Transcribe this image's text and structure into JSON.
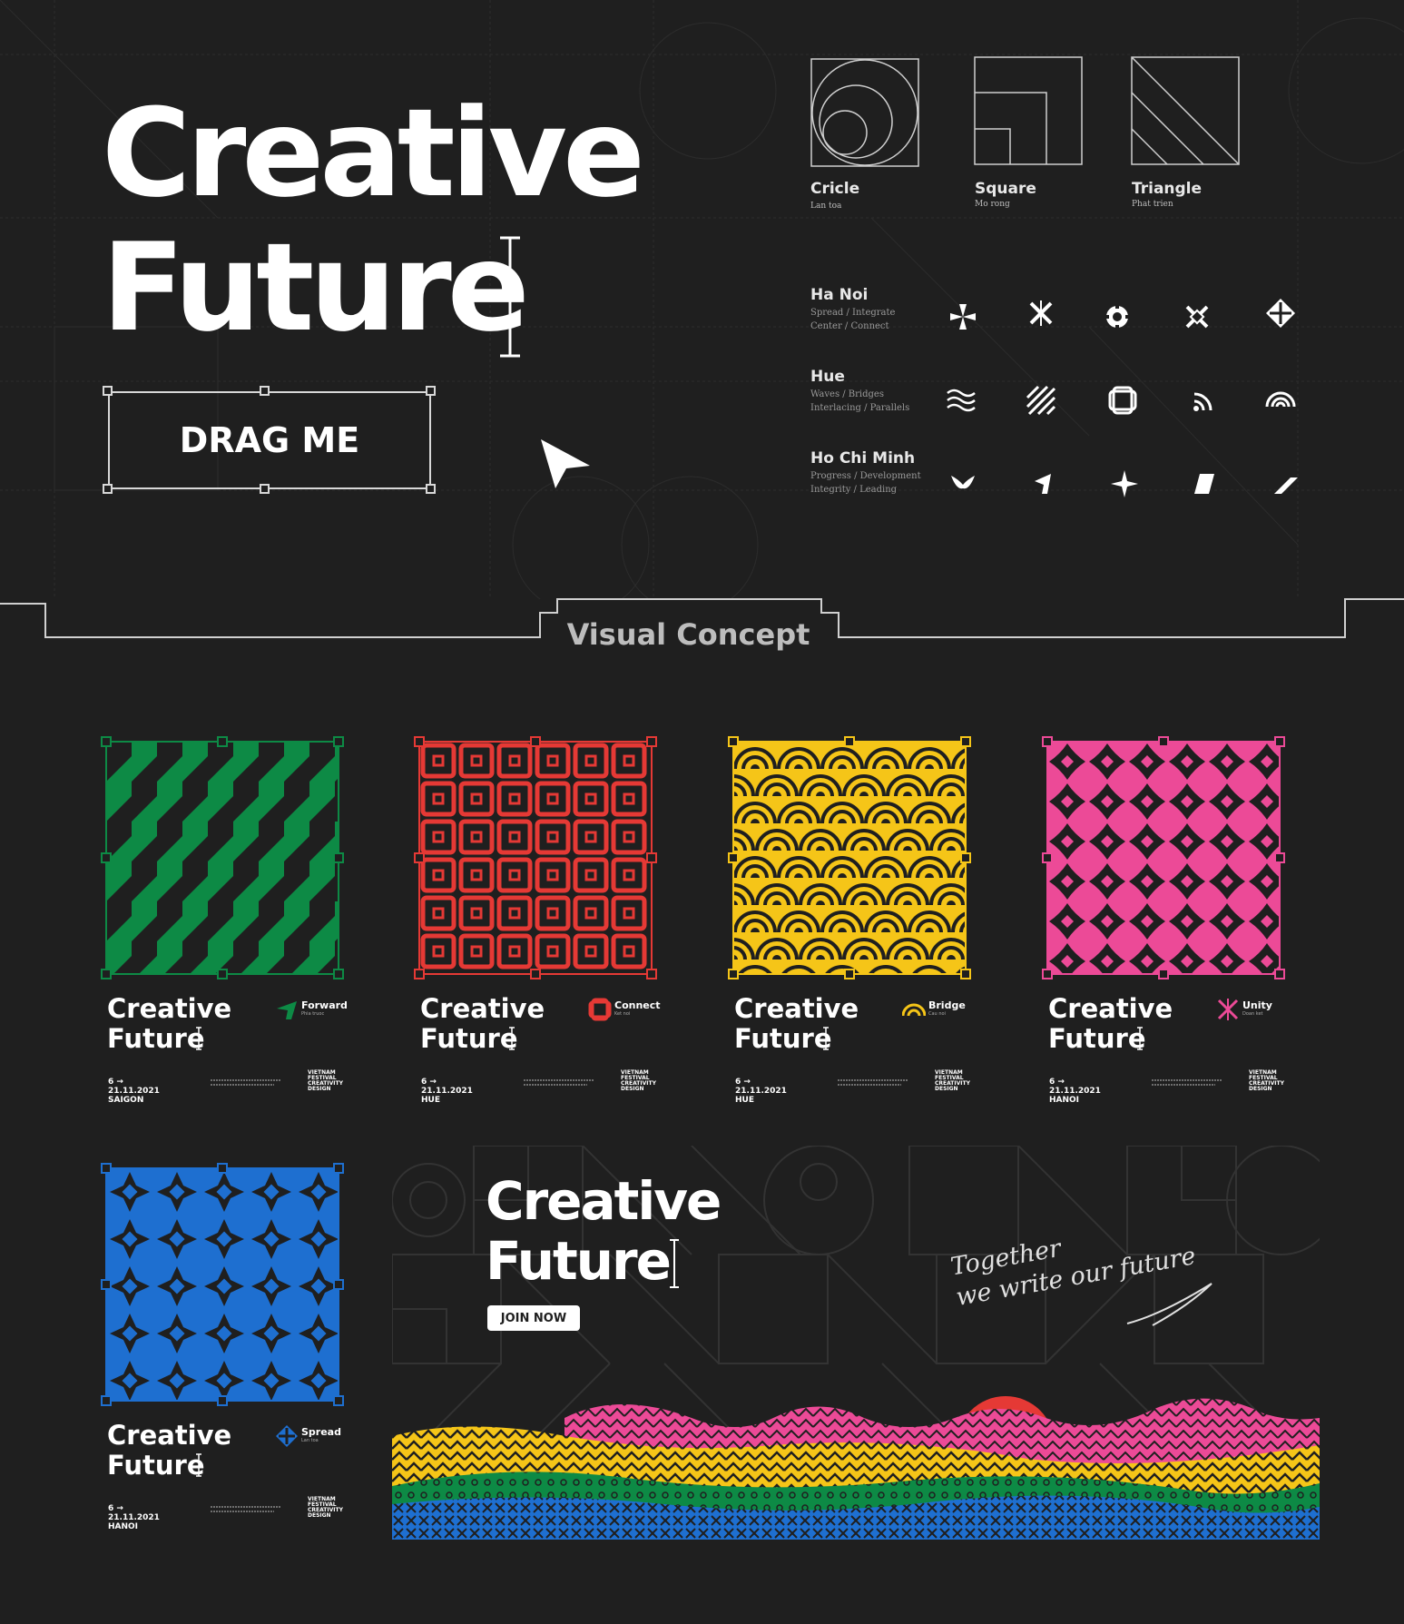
{
  "hero": {
    "title_line1": "Creative",
    "title_line2": "Future",
    "drag_label": "DRAG ME"
  },
  "shapes": [
    {
      "name": "Cricle",
      "sub": "Lan toa"
    },
    {
      "name": "Square",
      "sub": "Mo rong"
    },
    {
      "name": "Triangle",
      "sub": "Phat trien"
    }
  ],
  "cities": [
    {
      "name": "Ha Noi",
      "desc1": "Spread / Integrate",
      "desc2": "Center / Connect"
    },
    {
      "name": "Hue",
      "desc1": "Waves / Bridges",
      "desc2": "Interlacing / Parallels"
    },
    {
      "name": "Ho Chi Minh",
      "desc1": "Progress / Development",
      "desc2": "Integrity / Leading"
    }
  ],
  "section_title": "Visual Concept",
  "cards": [
    {
      "title1": "Creative",
      "title2": "Future",
      "tag": "Forward",
      "tag_sub": "Phia truoc",
      "date": "6 → 21.11.2021 SAIGON",
      "color": "#0d8a45",
      "pattern": "forward"
    },
    {
      "title1": "Creative",
      "title2": "Future",
      "tag": "Connect",
      "tag_sub": "Ket noi",
      "date": "6 → 21.11.2021 HUE",
      "color": "#e53935",
      "pattern": "connect"
    },
    {
      "title1": "Creative",
      "title2": "Future",
      "tag": "Bridge",
      "tag_sub": "Cau noi",
      "date": "6 → 21.11.2021 HUE",
      "color": "#f5c518",
      "pattern": "bridge"
    },
    {
      "title1": "Creative",
      "title2": "Future",
      "tag": "Unity",
      "tag_sub": "Doan ket",
      "date": "6 → 21.11.2021 HANOI",
      "color": "#ec4a97",
      "pattern": "unity"
    },
    {
      "title1": "Creative",
      "title2": "Future",
      "tag": "Spread",
      "tag_sub": "Lan toa",
      "date": "6 → 21.11.2021 HANOI",
      "color": "#1e6fd0",
      "pattern": "spread"
    }
  ],
  "logo_text": [
    "VIETNAM",
    "FESTIVAL",
    "CREATIVITY",
    "DESIGN"
  ],
  "banner": {
    "title_line1": "Creative",
    "title_line2": "Future",
    "button": "JOIN NOW",
    "script_line1": "Together",
    "script_line2": "we write our future"
  },
  "colors": {
    "background": "#1f1f1f",
    "green": "#0d8a45",
    "red": "#e53935",
    "yellow": "#f5c518",
    "pink": "#ec4a97",
    "blue": "#1e6fd0"
  }
}
